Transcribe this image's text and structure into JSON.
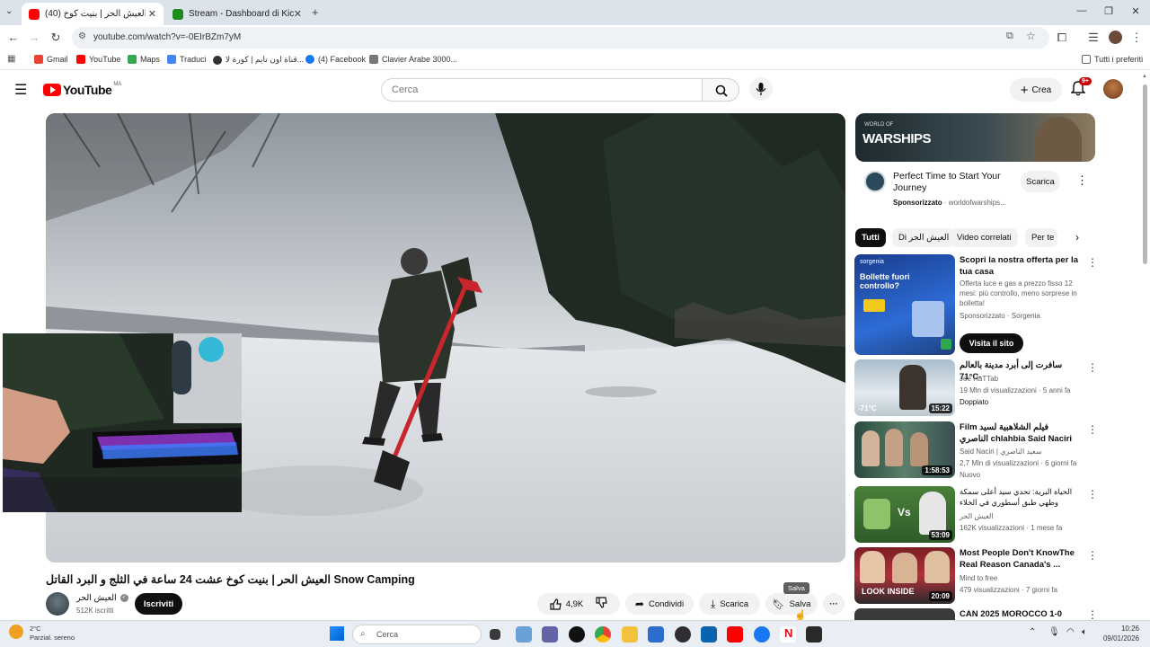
{
  "browser": {
    "tabs": [
      {
        "title": "(40) العيش الحر | بنيت كوخ ...",
        "active": true
      },
      {
        "title": "Stream - Dashboard di Kick",
        "active": false
      }
    ],
    "new_tab": "+",
    "url": "youtube.com/watch?v=-0EIrBZm7yM",
    "bookmarks": [
      "Gmail",
      "YouTube",
      "Maps",
      "Traduci",
      "قناة اون تايم | كورة لا...",
      "(4) Facebook",
      "Clavier Arabe 3000..."
    ],
    "all_bookmarks": "Tutti i preferiti"
  },
  "youtube": {
    "logo": "YouTube",
    "country": "MA",
    "search_placeholder": "Cerca",
    "create_label": "Crea",
    "notif_count": "9+"
  },
  "video": {
    "title": "العيش الحر | بنيت كوخ عشت 24 ساعة في الثلج و البرد القاتل Snow Camping",
    "channel_name": "العيش الحر",
    "subscribers": "512K iscritti",
    "subscribe_label": "Iscriviti",
    "likes": "4,9K",
    "share_label": "Condividi",
    "download_label": "Scarica",
    "save_label": "Salva",
    "tooltip": "Salva"
  },
  "ad": {
    "banner_text": "WARSHIPS",
    "banner_small": "WORLD OF",
    "title": "Perfect Time to Start Your Journey",
    "sponsored": "Sponsorizzato",
    "domain": "· worldofwarships...",
    "cta": "Scarica"
  },
  "chips": [
    "Tutti",
    "Di العيش الحر",
    "Video correlati",
    "Per te"
  ],
  "sidebar": [
    {
      "title": "Scopri la nostra offerta per la tua casa",
      "meta1": "Offerta luce e gas a prezzo fisso 12 mesi: più controllo, meno sorprese in bolletta!",
      "meta2": "Sponsorizzato · Sorgenia",
      "cta": "Visita il sito",
      "thumb_text": "Bollette fuori controllo?",
      "thumb_brand": "sorgenia"
    },
    {
      "title": "سافرت إلى أبرد مدينة بالعالم 71°C-",
      "channel": "Joe HaTTab",
      "stats": "19 Mln di visualizzazioni · 5 anni fa",
      "badge": "Doppiato",
      "duration": "15:22",
      "thumb_text": "-71°C"
    },
    {
      "title": "Film فيلم الشلاهبية لسيد الناصري chlahbia Said Naciri",
      "channel": "Said Naciri | سعيد الناصري",
      "stats": "2,7 Mln di visualizzazioni · 6 giorni fa",
      "badge": "Nuovo",
      "duration": "1:58:53"
    },
    {
      "title": "الحياة البرية: تحدي سيد أعلى سمكة وطهي طبق أسطوري في الخلاء",
      "channel": "العيش الحر",
      "stats": "162K visualizzazioni · 1 mese fa",
      "duration": "53:09"
    },
    {
      "title": "Most People Don't KnowThe Real Reason Canada's ...",
      "channel": "Mind to free",
      "stats": "479 visualizzazioni · 7 giorni fa",
      "duration": "20:09",
      "thumb_text": "LOOK INSIDE"
    },
    {
      "title": "CAN 2025 MOROCCO 1-0"
    }
  ],
  "taskbar": {
    "weather_temp": "2°C",
    "weather_desc": "Parzial. sereno",
    "search": "Cerca",
    "time": "10:26",
    "date": "09/01/2026"
  }
}
